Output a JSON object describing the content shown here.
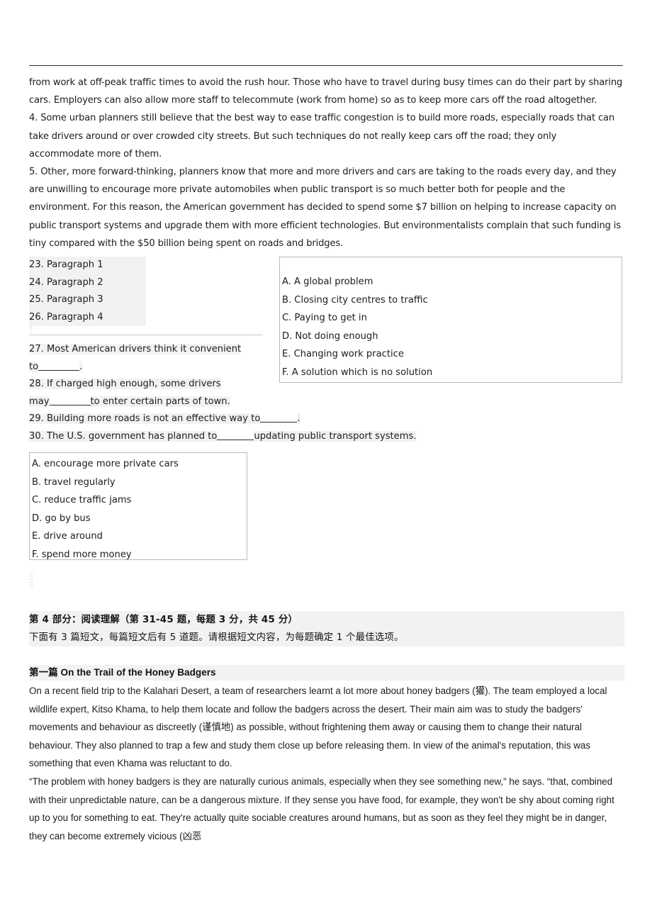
{
  "document": {
    "upper_passage": {
      "continued_paragraph": "from work at off-peak traffic times to avoid the rush hour. Those who have to travel during busy times can do their part by sharing cars. Employers can also allow more staff to telecommute (work from home) so as to keep more cars off the road altogether.",
      "paragraph_4": "4. Some urban planners still believe that the best way to ease traffic congestion is to build more roads, especially roads that can take drivers around or over crowded city streets. But such techniques do not really keep cars off the road; they only accommodate more of them.",
      "paragraph_5": "5. Other, more forward-thinking, planners know that more and more drivers and cars are taking to the roads every day, and they are unwilling to encourage more private automobiles when public transport is so much better both for people and the environment. For this reason, the American government has decided to spend some $7 billion on helping to increase capacity on public transport systems and upgrade them with more efficient technologies. But environmentalists complain that such funding is tiny compared with the $50 billion being spent on roads and bridges."
    },
    "matching_questions": [
      "23. Paragraph 1",
      "24. Paragraph 2",
      "25. Paragraph 3",
      "26. Paragraph 4"
    ],
    "topic_options": [
      "A. A global problem",
      "B. Closing city centres to traffic",
      "C. Paying to get in",
      "D. Not doing enough",
      "E. Changing work practice",
      "F. A solution which is no solution"
    ],
    "completion_questions": [
      {
        "number": "27.",
        "part1": "27. Most American drivers think it convenient",
        "part2_pre": "to",
        "part2_post": "."
      },
      {
        "number": "28.",
        "part1": "28. If charged high enough, some drivers",
        "part2_pre": "may",
        "part2_post": "to enter certain parts of town."
      },
      {
        "number": "29.",
        "part1": "29. Building more roads is not an effective way to",
        "part2_post": "."
      },
      {
        "number": "30.",
        "part1": "30. The U.S. government has planned to",
        "part2_post": "updating public transport systems."
      }
    ],
    "completion_options": [
      "A. encourage more private cars",
      "B. travel regularly",
      "C. reduce traffic jams",
      "D. go by bus",
      "E. drive around",
      "F. spend more money"
    ],
    "part_header": {
      "title": "第 4 部分：阅读理解（第 31-45 题，每题 3 分，共 45 分）",
      "subtitle": "下面有 3 篇短文，每篇短文后有 5 道题。请根据短文内容，为每题确定 1 个最佳选项。"
    },
    "passage": {
      "title": "第一篇 On the Trail of the Honey Badgers",
      "paragraph_1": "On a recent field trip to the Kalahari Desert, a team of researchers learnt a lot more about honey badgers (獾). The team employed a local wildlife expert, Kitso Khama, to help them locate and follow the badgers across the desert. Their main aim was to study the badgers' movements and behaviour as discreetly (谨慎地) as possible, without frightening them away or causing them to change their natural behaviour. They also planned to trap a few and study them close up before releasing them. In view of the animal's reputation, this was something that even Khama was reluctant to do.",
      "paragraph_2": "“The problem with honey badgers is they are naturally curious animals, especially when they see something new,” he says. “that, combined with their unpredictable nature, can be a dangerous mixture. If they sense you have food, for example, they won't be shy about coming right up to you for something to eat. They're actually quite sociable creatures around humans, but as soon as they feel they might be in danger, they can become extremely vicious (凶恶"
    }
  },
  "colors": {
    "text": "#1c1c1c",
    "rule": "#2b2b2b",
    "box_border": "#b9b9b9",
    "scan_tint": "#f2f2f2"
  }
}
